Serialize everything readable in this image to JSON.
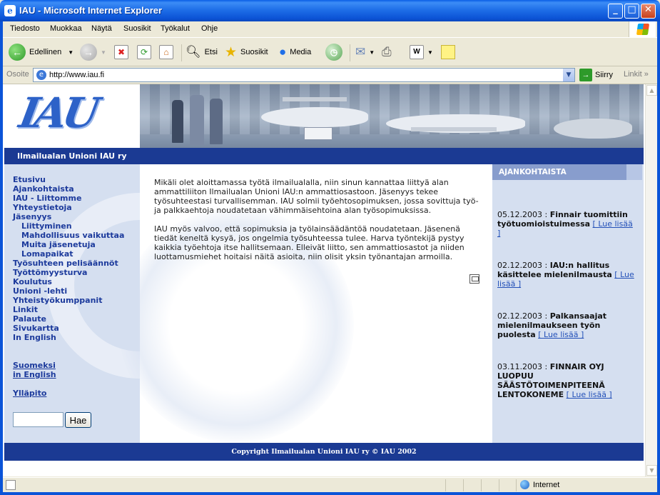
{
  "window": {
    "title": "IAU - Microsoft Internet Explorer",
    "buttons": {
      "minimize": "_",
      "maximize": "□",
      "close": "✕"
    }
  },
  "menu": [
    "Tiedosto",
    "Muokkaa",
    "Näytä",
    "Suosikit",
    "Työkalut",
    "Ohje"
  ],
  "toolbar": {
    "back": "Edellinen",
    "search": "Etsi",
    "favorites": "Suosikit",
    "media": "Media"
  },
  "address": {
    "label": "Osoite",
    "url": "http://www.iau.fi",
    "go": "Siirry",
    "links": "Linkit"
  },
  "site": {
    "logo": "IAU",
    "org_name": "Ilmailualan Unioni IAU ry",
    "nav": [
      {
        "label": "Etusivu",
        "sub": false
      },
      {
        "label": "Ajankohtaista",
        "sub": false
      },
      {
        "label": "IAU - Liittomme",
        "sub": false
      },
      {
        "label": "Yhteystietoja",
        "sub": false
      },
      {
        "label": "Jäsenyys",
        "sub": false
      },
      {
        "label": "Liittyminen",
        "sub": true
      },
      {
        "label": "Mahdollisuus vaikuttaa",
        "sub": true
      },
      {
        "label": "Muita jäsenetuja",
        "sub": true
      },
      {
        "label": "Lomapaikat",
        "sub": true
      },
      {
        "label": "Työsuhteen pelisäännöt",
        "sub": false
      },
      {
        "label": "Työttömyysturva",
        "sub": false
      },
      {
        "label": "Koulutus",
        "sub": false
      },
      {
        "label": "Unioni -lehti",
        "sub": false
      },
      {
        "label": "Yhteistyökumppanit",
        "sub": false
      },
      {
        "label": "Linkit",
        "sub": false
      },
      {
        "label": "Palaute",
        "sub": false
      },
      {
        "label": "Sivukartta",
        "sub": false
      },
      {
        "label": "In English",
        "sub": false
      }
    ],
    "lang_links": {
      "suomeksi": "Suomeksi",
      "in_english": "in English",
      "admin": "Ylläpito"
    },
    "search": {
      "value": "",
      "button": "Hae"
    },
    "intro": "Mikäli olet aloittamassa työtä ilmailualalla, niin sinun kannattaa liittyä alan ammattiliiton Ilmailualan Unioni IAU:n ammattiosastoon. Jäsenyys tekee työsuhteestasi turvallisemman. IAU solmii työehtosopimuksen, jossa sovittuja työ- ja palkkaehtoja noudatetaan vähimmäisehtoina alan työsopimuksissa.",
    "intro2": "IAU myös valvoo, että sopimuksia ja työlainsäädäntöä noudatetaan. Jäsenenä tiedät keneltä kysyä, jos ongelmia työsuhteessa tulee. Harva työntekijä pystyy kaikkia työehtoja itse hallitsemaan. Elleivät liitto, sen ammattiosastot ja niiden luottamusmiehet hoitaisi näitä asioita, niin olisit yksin työnantajan armoilla.",
    "news_header": "AJANKOHTAISTA",
    "news": [
      {
        "date": "05.12.2003",
        "title": "Finnair tuomittiin työtuomioistuimessa",
        "more": "[ Lue lisää ]"
      },
      {
        "date": "02.12.2003",
        "title": "IAU:n hallitus käsittelee mielenilmausta",
        "more": "[ Lue lisää ]"
      },
      {
        "date": "02.12.2003",
        "title": "Palkansaajat mielenilmaukseen työn puolesta",
        "more": "[ Lue lisää ]"
      },
      {
        "date": "03.11.2003",
        "title": "FINNAIR OYJ LUOPUU SÄÄSTÖTOIMENPITEENÄ LENTOKONEME",
        "more": "[ Lue lisää ]"
      }
    ],
    "footer": "Copyright Ilmailualan Unioni IAU ry © IAU 2002"
  },
  "status": {
    "zone": "Internet"
  },
  "colors": {
    "brand_blue": "#1b3a93",
    "panel_blue": "#d5dff0",
    "news_header": "#889dcd",
    "link": "#1c3a9c"
  }
}
